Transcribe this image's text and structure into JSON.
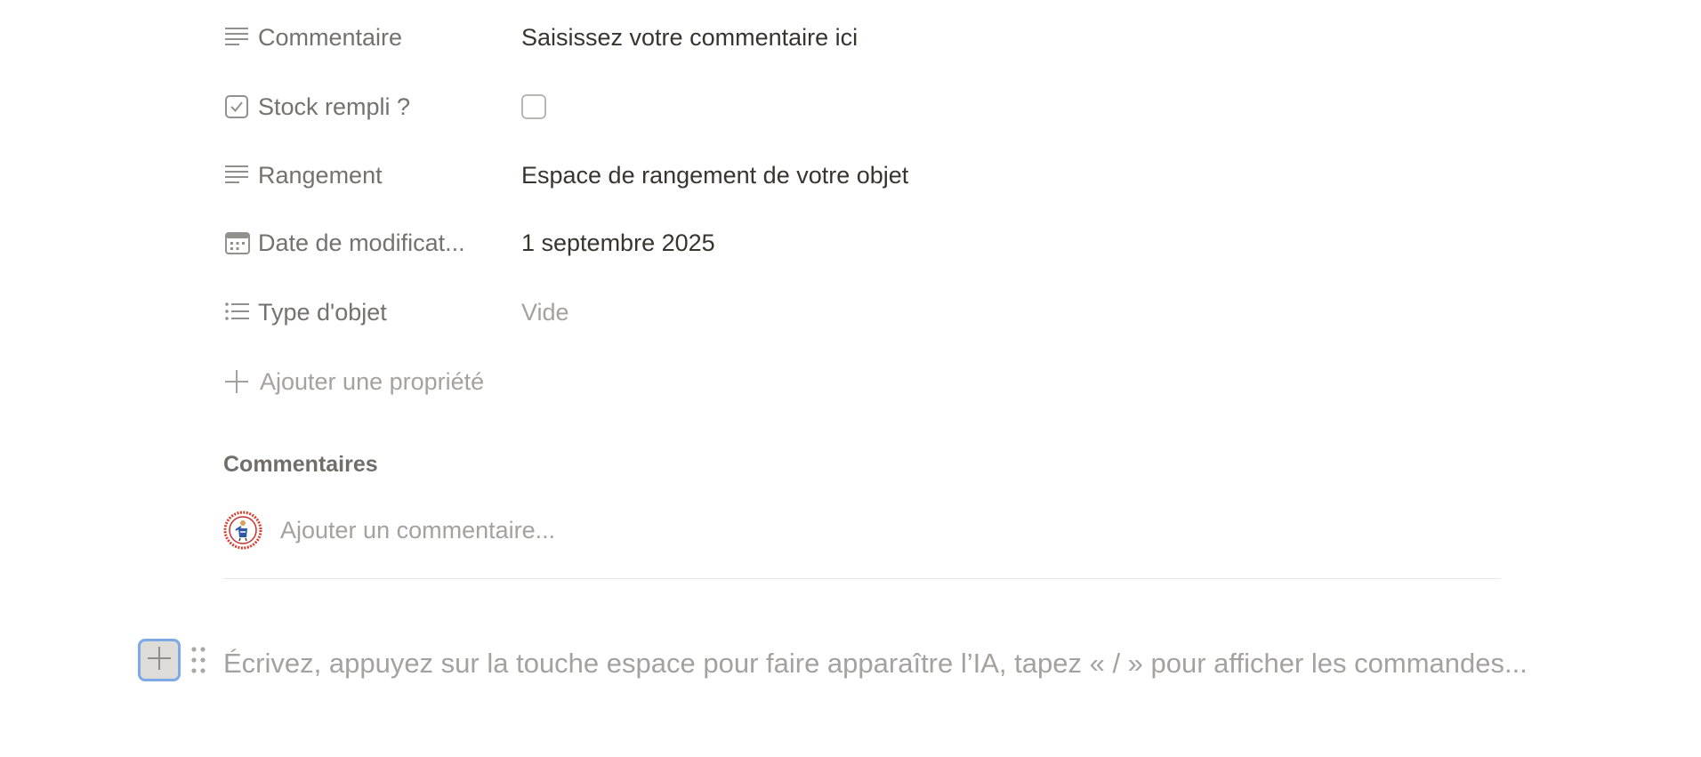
{
  "properties": [
    {
      "icon": "text-lines-icon",
      "label": "Commentaire",
      "value": "Saisissez votre commentaire ici",
      "type": "text"
    },
    {
      "icon": "checkbox-icon",
      "label": "Stock rempli ?",
      "value": "",
      "type": "checkbox",
      "checked": false
    },
    {
      "icon": "text-lines-icon",
      "label": "Rangement",
      "value": "Espace de rangement de votre objet",
      "type": "text"
    },
    {
      "icon": "calendar-icon",
      "label": "Date de modificat...",
      "value": "1 septembre 2025",
      "type": "date"
    },
    {
      "icon": "list-icon",
      "label": "Type d'objet",
      "value": "Vide",
      "type": "select-empty"
    }
  ],
  "add_property": {
    "label": "Ajouter une propriété",
    "icon": "plus-icon"
  },
  "comments": {
    "title": "Commentaires",
    "placeholder": "Ajouter un commentaire...",
    "avatar_icon": "user-avatar"
  },
  "editor": {
    "placeholder": "Écrivez, appuyez sur la touche espace pour faire apparaître l’IA, tapez « / » pour afficher les commandes...",
    "add_block_icon": "plus-icon",
    "drag_handle_icon": "drag-handle-icon"
  },
  "colors": {
    "text_primary": "#37352f",
    "text_secondary": "#73726e",
    "placeholder": "#a3a29e",
    "focus_ring": "#7ea8e6"
  }
}
